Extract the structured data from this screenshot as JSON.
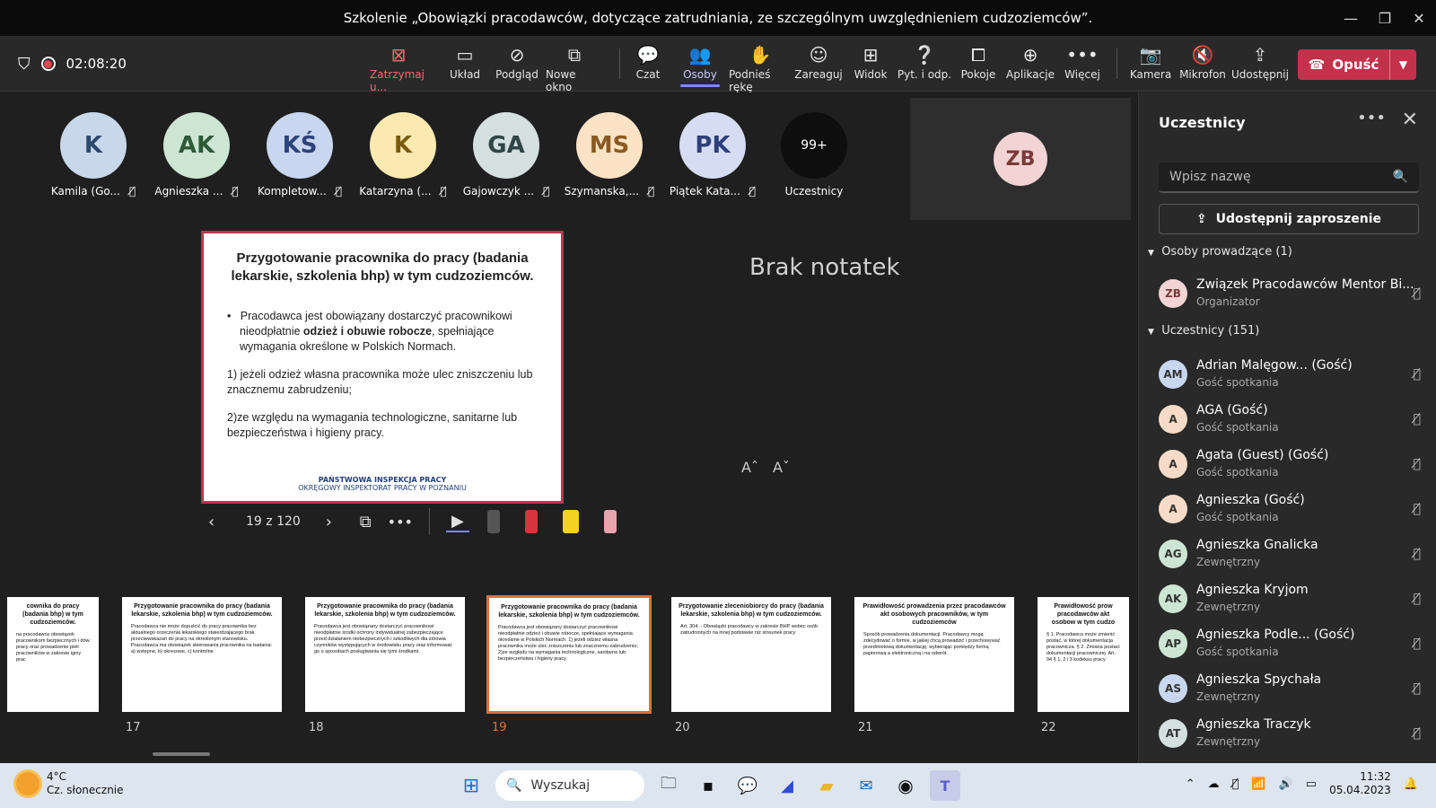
{
  "window": {
    "title": "Szkolenie „Obowiązki pracodawców, dotyczące zatrudniania, ze szczególnym uwzględnieniem cudzoziemców”."
  },
  "meeting": {
    "timer": "02:08:20"
  },
  "toolbar": {
    "stop": "Zatrzymaj u...",
    "layout": "Układ",
    "preview": "Podgląd",
    "new_window": "Nowe okno",
    "chat": "Czat",
    "people": "Osoby",
    "raise_hand": "Podnieś rękę",
    "react": "Zareaguj",
    "view": "Widok",
    "qa": "Pyt. i odp.",
    "rooms": "Pokoje",
    "apps": "Aplikacje",
    "more": "Więcej",
    "camera": "Kamera",
    "mic": "Mikrofon",
    "share": "Udostępnij",
    "leave": "Opuść"
  },
  "participants_row": [
    {
      "initials": "K",
      "name": "Kamila (Go...",
      "bg": "#c8d7ea",
      "fg": "#2d4a6e"
    },
    {
      "initials": "AK",
      "name": "Agnieszka ...",
      "bg": "#cde6d3",
      "fg": "#2f5a3a"
    },
    {
      "initials": "KŚ",
      "name": "Kompletow...",
      "bg": "#c9d6f0",
      "fg": "#2d437a"
    },
    {
      "initials": "K",
      "name": "Katarzyna (...",
      "bg": "#fbe9b0",
      "fg": "#7a5a10"
    },
    {
      "initials": "GA",
      "name": "Gajowczyk ...",
      "bg": "#d4dfe0",
      "fg": "#2e4648"
    },
    {
      "initials": "MS",
      "name": "Szymanska,...",
      "bg": "#fde3c5",
      "fg": "#8a5a22"
    },
    {
      "initials": "PK",
      "name": "Piątek Kata...",
      "bg": "#d5dcf3",
      "fg": "#2f3f7a"
    }
  ],
  "overflow": {
    "count": "99+",
    "label": "Uczestnicy"
  },
  "self_view": {
    "initials": "ZB"
  },
  "slide": {
    "title": "Przygotowanie pracownika do pracy (badania lekarskie, szkolenia bhp) w tym cudzoziemców.",
    "bullet_pre": "Pracodawca jest obowiązany dostarczyć pracownikowi nieodpłatnie ",
    "bullet_bold": "odzież i obuwie robocze",
    "bullet_post": ", spełniające wymagania określone w Polskich Normach.",
    "p1": "1) jeżeli odzież własna pracownika może ulec zniszczeniu lub znacznemu zabrudzeniu;",
    "p2": "2)ze względu na wymagania technologiczne, sanitarne lub bezpieczeństwa i higieny pracy.",
    "footer1": "PAŃSTWOWA INSPEKCJA PRACY",
    "footer2": "OKRĘGOWY INSPEKTORAT PRACY W POZNANIU"
  },
  "notes": {
    "empty": "Brak notatek",
    "font_up": "Aˆ",
    "font_down": "Aˇ"
  },
  "controls": {
    "page": "19 z 120"
  },
  "thumbnails": [
    {
      "num": "",
      "title": "cownika do pracy (badania bhp) w tym cudzoziemców.",
      "text": "na pracodawcę obowiązek pracownikom bezpiecznych i dów pracy oraz prowadzenie pieli pracowników w zakresie iginy prac"
    },
    {
      "num": "17",
      "title": "Przygotowanie pracownika do pracy (badania lekarskie, szkolenia bhp) w tym cudzoziemców.",
      "text": "Pracodawca nie może dopuścić do pracy pracownika bez aktualnego orzeczenia lekarskiego stwierdzającego brak przeciwwskazań do pracy na określonym stanowisku. Pracodawca ma obowiązek skierowania pracownika na badania: a) wstępne, b) okresowe, c) kontrolne"
    },
    {
      "num": "18",
      "title": "Przygotowanie pracownika do pracy (badania lekarskie, szkolenia bhp) w tym cudzoziemców.",
      "text": "Pracodawca jest obowiązany dostarczyć pracownikowi nieodpłatnie środki ochrony indywidualnej zabezpieczające przed działaniem niebezpiecznych i szkodliwych dla zdrowia czynników występujących w środowisku pracy oraz informować go o sposobach posługiwania się tymi środkami."
    },
    {
      "num": "19",
      "title": "Przygotowanie pracownika do pracy (badania lekarskie, szkolenia bhp) w tym cudzoziemców.",
      "text": "Pracodawca jest obowiązany dostarczyć pracownikowi nieodpłatnie odzież i obuwie robocze, spełniające wymagania określone w Polskich Normach. 1) jeżeli odzież własna pracownika może ulec zniszczeniu lub znacznemu zabrudzeniu; 2)ze względu na wymagania technologiczne, sanitarne lub bezpieczeństwa i higieny pracy."
    },
    {
      "num": "20",
      "title": "Przygotowanie zleceniobiorcy do pracy (badania lekarskie, szkolenia bhp) w tym cudzoziemców.",
      "text": "Art. 304. - Obowiązki pracodawcy w zakresie BHP wobec osób zatrudnionych na innej podstawie niż stosunek pracy"
    },
    {
      "num": "21",
      "title": "Prawidłowość prowadzenia przez pracodawców akt osobowych pracowników, w tym cudzoziemców",
      "text": "Sposób prowadzenia dokumentacji. Pracodawcy mogą zdecydować o formie, w jakiej chcą prowadzić i przechowywać przedmiotową dokumentację, wybierając pomiędzy formą papierową a elektroniczną i na odwrót."
    },
    {
      "num": "22",
      "title": "Prawidłowość prow pracodawców akt osobow w tym cudzo",
      "text": "§ 1. Pracodawca może zmienić postać, w której dokumentacja pracownicza. § 2. Zmiana postaci dokumentacji pracowniczej. Art. 94 § 1, 2 i 3 kodeksu pracy"
    }
  ],
  "panel": {
    "title": "Uczestnicy",
    "search_placeholder": "Wpisz nazwę",
    "invite": "Udostępnij zaproszenie",
    "presenters_header": "Osoby prowadzące (1)",
    "attendees_header": "Uczestnicy (151)",
    "presenters": [
      {
        "initials": "ZB",
        "name": "Związek Pracodawców Mentor Bi...",
        "role": "Organizator",
        "bg": "#f2d4d4"
      }
    ],
    "attendees": [
      {
        "initials": "AM",
        "name": "Adrian Malęgow... (Gość)",
        "role": "Gość spotkania",
        "bg": "#c9d6f0"
      },
      {
        "initials": "A",
        "name": "AGA (Gość)",
        "role": "Gość spotkania",
        "bg": "#f6dcc8"
      },
      {
        "initials": "A",
        "name": "Agata (Guest) (Gość)",
        "role": "Gość spotkania",
        "bg": "#f6dcc8"
      },
      {
        "initials": "A",
        "name": "Agnieszka (Gość)",
        "role": "Gość spotkania",
        "bg": "#f6dcc8"
      },
      {
        "initials": "AG",
        "name": "Agnieszka Gnalicka",
        "role": "Zewnętrzny",
        "bg": "#cde6d3"
      },
      {
        "initials": "AK",
        "name": "Agnieszka Kryjom",
        "role": "Zewnętrzny",
        "bg": "#cde6d3"
      },
      {
        "initials": "AP",
        "name": "Agnieszka Podle... (Gość)",
        "role": "Gość spotkania",
        "bg": "#cde6d3"
      },
      {
        "initials": "AS",
        "name": "Agnieszka Spychała",
        "role": "Zewnętrzny",
        "bg": "#c9d6f0"
      },
      {
        "initials": "AT",
        "name": "Agnieszka Traczyk",
        "role": "Zewnętrzny",
        "bg": "#d4dfe0"
      }
    ]
  },
  "taskbar": {
    "temp": "4°C",
    "weather": "Cz. słonecznie",
    "search": "Wyszukaj",
    "time": "11:32",
    "date": "05.04.2023"
  }
}
